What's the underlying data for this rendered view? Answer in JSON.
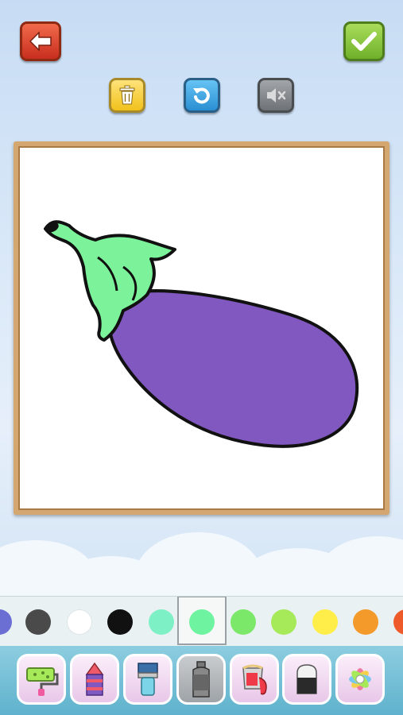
{
  "toolbar": {
    "back": {
      "icon": "back-arrow-icon",
      "color": "#d9412c"
    },
    "done": {
      "icon": "checkmark-icon",
      "color": "#8cc63f"
    },
    "trash": {
      "icon": "trash-icon",
      "color": "#f5cf3b"
    },
    "undo": {
      "icon": "undo-icon",
      "color": "#3a9fe0"
    },
    "mute": {
      "icon": "speaker-muted-icon",
      "color": "#8a8d90"
    }
  },
  "drawing": {
    "subject": "eggplant",
    "body_color": "#8058bf",
    "leaf_color": "#7cf39a",
    "outline_color": "#111111"
  },
  "palette": {
    "colors": [
      "#6b6fd4",
      "#4a4a4a",
      "#ffffff",
      "#111111",
      "#7ef0c6",
      "#6ef3a0",
      "#7ce86a",
      "#a6ea5a",
      "#ffee4a",
      "#f39a2a",
      "#ef5a2a"
    ],
    "selected_color": "#6ef3a0"
  },
  "tools": [
    {
      "name": "paint-roller-icon",
      "selected": false
    },
    {
      "name": "crayon-icon",
      "selected": false
    },
    {
      "name": "paintbrush-icon",
      "selected": false
    },
    {
      "name": "spray-can-icon",
      "selected": true
    },
    {
      "name": "paint-bucket-icon",
      "selected": false
    },
    {
      "name": "eraser-icon",
      "selected": false
    },
    {
      "name": "pattern-flower-icon",
      "selected": false
    }
  ]
}
